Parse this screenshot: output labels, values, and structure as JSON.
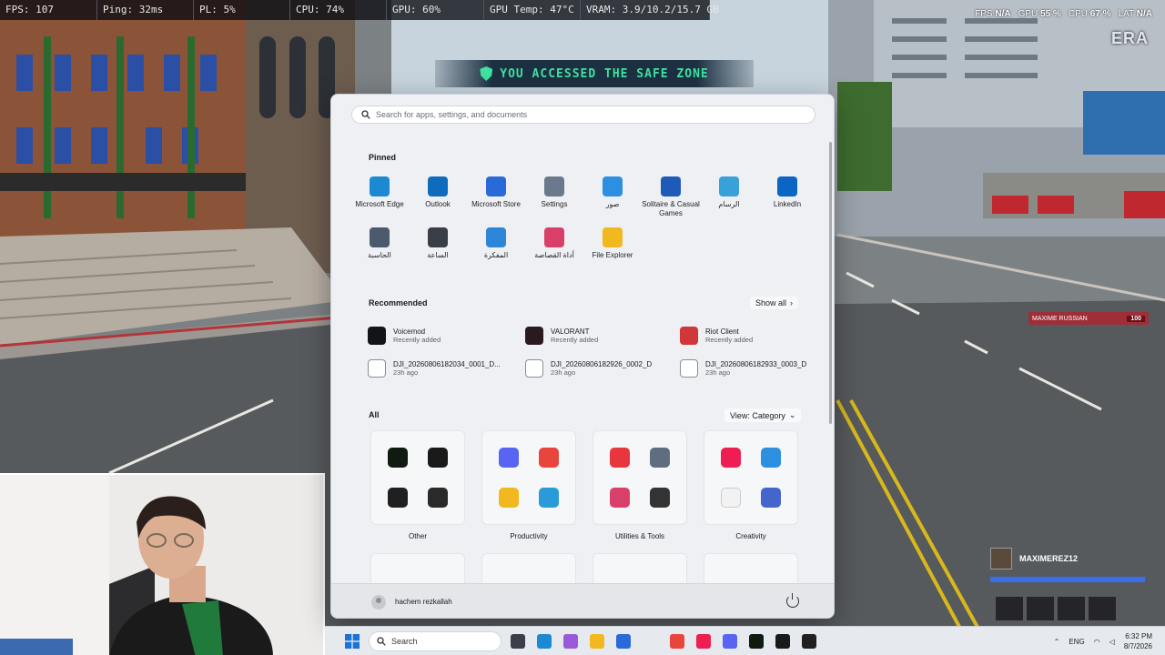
{
  "overlay_stats": [
    "FPS: 107",
    "Ping: 32ms",
    "PL: 5%",
    "CPU: 74%",
    "GPU: 60%",
    "GPU Temp: 47°C",
    "VRAM: 3.9/10.2/15.7 GB"
  ],
  "perf_right": {
    "fps_label": "FPS",
    "fps_value": "N/A",
    "gpu_label": "GPU",
    "gpu_value": "55 %",
    "cpu_label": "CPU",
    "cpu_value": "67 %",
    "lat_label": "LAT",
    "lat_value": "N/A"
  },
  "server_logo": "ERA",
  "safe_zone_text": "YOU ACCESSED THE SAFE ZONE",
  "player_tag": {
    "name": "MAXIME RUSSIAN",
    "level": "100"
  },
  "hud": {
    "player_name": "MAXIMEREZ12",
    "health_fraction": 1.0
  },
  "start_menu": {
    "search_placeholder": "Search for apps, settings, and documents",
    "pinned_title": "Pinned",
    "pinned": [
      {
        "label": "Microsoft Edge",
        "icon": "edge-icon",
        "color": "#1b8ad3"
      },
      {
        "label": "Outlook",
        "icon": "outlook-icon",
        "color": "#0f6cbd"
      },
      {
        "label": "Microsoft Store",
        "icon": "store-icon",
        "color": "#2a6ad8"
      },
      {
        "label": "Settings",
        "icon": "gear-icon",
        "color": "#6a7a8c"
      },
      {
        "label": "صور",
        "icon": "photos-icon",
        "color": "#2c8fe0"
      },
      {
        "label": "Solitaire & Casual Games",
        "icon": "cards-icon",
        "color": "#1e5bb8"
      },
      {
        "label": "الرسام",
        "icon": "paint-icon",
        "color": "#3aa0d8"
      },
      {
        "label": "LinkedIn",
        "icon": "linkedin-icon",
        "color": "#0a66c2"
      },
      {
        "label": "الحاسبة",
        "icon": "calculator-icon",
        "color": "#4b5a6c"
      },
      {
        "label": "الساعة",
        "icon": "clock-icon",
        "color": "#3a3e46"
      },
      {
        "label": "المفكرة",
        "icon": "notepad-icon",
        "color": "#2d86d8"
      },
      {
        "label": "أداة القصاصة",
        "icon": "snipping-icon",
        "color": "#d8406a"
      },
      {
        "label": "File Explorer",
        "icon": "folder-icon",
        "color": "#f2b81f"
      }
    ],
    "recommended_title": "Recommended",
    "show_all": "Show all",
    "recommended": [
      {
        "name": "Voicemod",
        "sub": "Recently added",
        "icon": "voicemod-icon",
        "color": "#111418"
      },
      {
        "name": "VALORANT",
        "sub": "Recently added",
        "icon": "valorant-icon",
        "color": "#2a1a1f"
      },
      {
        "name": "Riot Client",
        "sub": "Recently added",
        "icon": "riot-icon",
        "color": "#d1363a"
      },
      {
        "name": "DJI_20260806182034_0001_D...",
        "sub": "23h ago",
        "icon": "file-icon",
        "color": "#ffffff"
      },
      {
        "name": "DJI_20260806182926_0002_D",
        "sub": "23h ago",
        "icon": "image-file-icon",
        "color": "#ffffff"
      },
      {
        "name": "DJI_20260806182933_0003_D",
        "sub": "23h ago",
        "icon": "image-file-icon",
        "color": "#ffffff"
      }
    ],
    "all_title": "All",
    "view_label": "View: Category",
    "categories": [
      {
        "label": "Other",
        "icons": [
          {
            "icon": "arrow-a-icon",
            "color": "#0f1a10"
          },
          {
            "icon": "mail-icon",
            "color": "#1a1a1a"
          },
          {
            "icon": "obs-icon",
            "color": "#202020"
          },
          {
            "icon": "nvidia-icon",
            "color": "#2a2a2a"
          }
        ]
      },
      {
        "label": "Productivity",
        "icons": [
          {
            "icon": "discord-icon",
            "color": "#5865f2"
          },
          {
            "icon": "chrome-icon",
            "color": "#e8453c"
          },
          {
            "icon": "folder-icon",
            "color": "#f2b81f"
          },
          {
            "icon": "copilot-icon",
            "color": "#2a9ad8"
          }
        ]
      },
      {
        "label": "Utilities & Tools",
        "icons": [
          {
            "icon": "anydesk-icon",
            "color": "#e8363c"
          },
          {
            "icon": "gear-icon",
            "color": "#5e6e80"
          },
          {
            "icon": "snipping-icon",
            "color": "#d8406a"
          },
          {
            "icon": "qr-icon",
            "color": "#333333"
          }
        ]
      },
      {
        "label": "Creativity",
        "icons": [
          {
            "icon": "tiktok-icon",
            "color": "#ee1d52"
          },
          {
            "icon": "photos-icon",
            "color": "#2c8fe0"
          },
          {
            "icon": "capcut-icon",
            "color": "#f2f2f2"
          },
          {
            "icon": "studio-icon",
            "color": "#4466cc"
          }
        ]
      }
    ],
    "user_name": "hachem rezkallah"
  },
  "taskbar": {
    "search_label": "Search",
    "language": "ENG",
    "time": "6:32 PM",
    "date": "8/7/2026",
    "icons": [
      {
        "icon": "task-view-icon",
        "color": "#3a3f47"
      },
      {
        "icon": "edge-icon",
        "color": "#1b8ad3"
      },
      {
        "icon": "copilot-icon",
        "color": "#9a5ad8"
      },
      {
        "icon": "folder-icon",
        "color": "#f2b81f"
      },
      {
        "icon": "store-icon",
        "color": "#2a6ad8"
      },
      {
        "icon": "chrome-icon",
        "color": "#e8453c"
      },
      {
        "icon": "tiktok-icon",
        "color": "#ee1d52"
      },
      {
        "icon": "discord-icon",
        "color": "#5865f2"
      },
      {
        "icon": "arrow-a-icon",
        "color": "#0f1a10"
      },
      {
        "icon": "mail-icon",
        "color": "#1a1a1a"
      },
      {
        "icon": "obs-icon",
        "color": "#202020"
      }
    ]
  }
}
